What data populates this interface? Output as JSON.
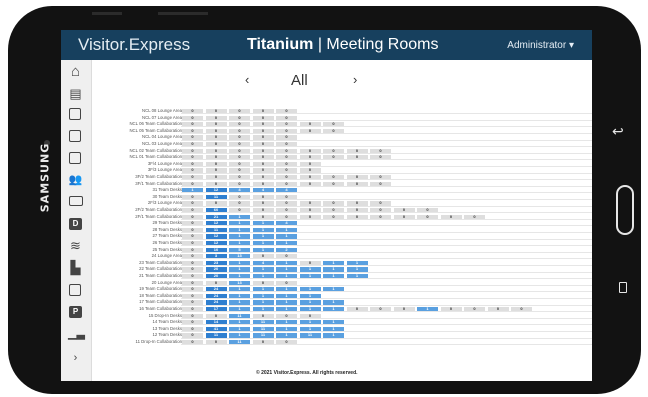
{
  "device": {
    "brand": "SAMSUNG"
  },
  "app": {
    "logo": "Visitor.Express",
    "title_bold": "Titanium",
    "title_rest": " | Meeting Rooms",
    "user": "Administrator",
    "user_caret": "▾"
  },
  "sidebar": {
    "items": [
      {
        "icon": "home-icon"
      },
      {
        "icon": "building-icon"
      },
      {
        "icon": "calendar-add-icon"
      },
      {
        "icon": "badge-icon"
      },
      {
        "icon": "calendar-list-icon"
      },
      {
        "icon": "people-icon"
      },
      {
        "icon": "monitor-icon"
      },
      {
        "icon": "d-icon",
        "glyph": "D"
      },
      {
        "icon": "layers-icon"
      },
      {
        "icon": "door-icon"
      },
      {
        "icon": "calendar-icon"
      },
      {
        "icon": "parking-icon",
        "glyph": "P"
      },
      {
        "icon": "chart-icon"
      },
      {
        "icon": "expand-icon"
      }
    ]
  },
  "nav": {
    "prev": "‹",
    "filter": "All",
    "next": "›"
  },
  "rooms": [
    {
      "name": "NCL 08 Lounge Area",
      "values": [
        "0",
        "0",
        "0",
        "0",
        "0"
      ]
    },
    {
      "name": "NCL 07 Lounge Area",
      "values": [
        "0",
        "0",
        "0",
        "0",
        "0"
      ]
    },
    {
      "name": "NCL 06 Team Collaboration",
      "values": [
        "0",
        "0",
        "0",
        "0",
        "0",
        "0",
        "0"
      ]
    },
    {
      "name": "NCL 05 Team Collaboration",
      "values": [
        "0",
        "0",
        "0",
        "0",
        "0",
        "0",
        "0"
      ]
    },
    {
      "name": "NCL 04 Lounge Area",
      "values": [
        "0",
        "0",
        "0",
        "0",
        "0"
      ]
    },
    {
      "name": "NCL 03 Lounge Area",
      "values": [
        "0",
        "0",
        "0",
        "0",
        "0"
      ]
    },
    {
      "name": "NCL 02 Team Collaboration",
      "values": [
        "0",
        "0",
        "0",
        "0",
        "0",
        "0",
        "0",
        "0",
        "0"
      ]
    },
    {
      "name": "NCL 01 Team Collaboration",
      "values": [
        "0",
        "0",
        "0",
        "0",
        "0",
        "0",
        "0",
        "0",
        "0"
      ]
    },
    {
      "name": "3F/4 Lounge Area",
      "values": [
        "0",
        "0",
        "0",
        "0",
        "0",
        "0"
      ]
    },
    {
      "name": "3F/3 Lounge Area",
      "values": [
        "0",
        "0",
        "0",
        "0",
        "0",
        "0"
      ]
    },
    {
      "name": "3F/2 Team Collaboration",
      "values": [
        "0",
        "0",
        "0",
        "0",
        "0",
        "0",
        "0",
        "0",
        "0"
      ]
    },
    {
      "name": "3F/1 Team Collaboration",
      "values": [
        "0",
        "0",
        "0",
        "0",
        "0",
        "0",
        "0",
        "0",
        "0"
      ]
    },
    {
      "name": "31 Team Desks",
      "values": [
        "1",
        "12",
        "4",
        "4",
        "4"
      ],
      "hl": [
        0,
        1,
        2,
        3,
        4
      ]
    },
    {
      "name": "30 Team Desks",
      "values": [
        "0",
        "11",
        "0",
        "0",
        "0"
      ],
      "hl": [
        1
      ]
    },
    {
      "name": "2F/3 Lounge Area",
      "values": [
        "0",
        "0",
        "0",
        "0",
        "0",
        "0",
        "0",
        "0",
        "0"
      ]
    },
    {
      "name": "2F/2 Team Collaboration",
      "values": [
        "0",
        "60",
        "0",
        "0",
        "0",
        "0",
        "0",
        "0",
        "0",
        "0",
        "0"
      ],
      "hl": [
        1
      ]
    },
    {
      "name": "2F/1 Team Collaboration",
      "values": [
        "0",
        "21",
        "1",
        "0",
        "0",
        "0",
        "0",
        "0",
        "0",
        "0",
        "0",
        "0",
        "0"
      ],
      "hl": [
        1,
        2
      ]
    },
    {
      "name": "29 Team Desks",
      "values": [
        "0",
        "12",
        "1",
        "1",
        "4"
      ],
      "hl": [
        1,
        2,
        3,
        4
      ]
    },
    {
      "name": "28 Team Desks",
      "values": [
        "0",
        "11",
        "1",
        "1",
        "1"
      ],
      "hl": [
        1,
        2,
        3,
        4
      ]
    },
    {
      "name": "27 Team Desks",
      "values": [
        "0",
        "12",
        "1",
        "1",
        "1"
      ],
      "hl": [
        1,
        2,
        3,
        4
      ]
    },
    {
      "name": "26 Team Desks",
      "values": [
        "0",
        "12",
        "1",
        "1",
        "1"
      ],
      "hl": [
        1,
        2,
        3,
        4
      ]
    },
    {
      "name": "25 Team Desks",
      "values": [
        "0",
        "10",
        "5",
        "1",
        "2"
      ],
      "hl": [
        1,
        2,
        3,
        4
      ]
    },
    {
      "name": "24 Lounge Area",
      "values": [
        "0",
        "3",
        "13",
        "0",
        "0"
      ],
      "hl": [
        1,
        2
      ]
    },
    {
      "name": "23 Team Collaboration",
      "values": [
        "0",
        "23",
        "1",
        "4",
        "1",
        "0",
        "1",
        "1"
      ],
      "hl": [
        1,
        2,
        3,
        4,
        6,
        7
      ]
    },
    {
      "name": "22 Team Collaboration",
      "values": [
        "0",
        "20",
        "1",
        "1",
        "1",
        "1",
        "1",
        "1"
      ],
      "hl": [
        1,
        2,
        3,
        4,
        5,
        6,
        7
      ]
    },
    {
      "name": "21 Team Collaboration",
      "values": [
        "0",
        "20",
        "1",
        "1",
        "1",
        "1",
        "1",
        "1"
      ],
      "hl": [
        1,
        2,
        3,
        4,
        5,
        6,
        7
      ]
    },
    {
      "name": "20 Lounge Area",
      "values": [
        "0",
        "0",
        "13",
        "0",
        "0"
      ],
      "hl": [
        2
      ]
    },
    {
      "name": "19 Team Collaboration",
      "values": [
        "0",
        "24",
        "1",
        "1",
        "1",
        "1",
        "1"
      ],
      "hl": [
        1,
        2,
        3,
        4,
        5,
        6
      ]
    },
    {
      "name": "18 Team Collaboration",
      "values": [
        "0",
        "24",
        "1",
        "1",
        "1",
        "1"
      ],
      "hl": [
        1,
        2,
        3,
        4,
        5
      ]
    },
    {
      "name": "17 Team Collaboration",
      "values": [
        "0",
        "24",
        "1",
        "1",
        "1",
        "1",
        "1"
      ],
      "hl": [
        1,
        2,
        3,
        4,
        5,
        6
      ]
    },
    {
      "name": "16 Team Collaboration",
      "values": [
        "0",
        "17",
        "1",
        "1",
        "1",
        "1",
        "1",
        "0",
        "0",
        "0",
        "1",
        "0",
        "0",
        "0",
        "0"
      ],
      "hl": [
        1,
        2,
        3,
        4,
        5,
        6,
        10
      ]
    },
    {
      "name": "15 Drop-In Desks",
      "values": [
        "0",
        "0",
        "11",
        "0",
        "0",
        "0"
      ],
      "hl": [
        2
      ]
    },
    {
      "name": "14 Team Desks",
      "values": [
        "0",
        "14",
        "1",
        "11",
        "1",
        "1",
        "1"
      ],
      "hl": [
        1,
        2,
        3,
        4,
        5,
        6
      ]
    },
    {
      "name": "13 Team Desks",
      "values": [
        "0",
        "41",
        "1",
        "11",
        "1",
        "1",
        "1"
      ],
      "hl": [
        1,
        2,
        3,
        4,
        5,
        6
      ]
    },
    {
      "name": "12 Team Desks",
      "values": [
        "0",
        "11",
        "1",
        "11",
        "1",
        "11",
        "1"
      ],
      "hl": [
        1,
        2,
        3,
        4,
        5,
        6
      ]
    },
    {
      "name": "11 Drop-In Collaboration",
      "values": [
        "0",
        "0",
        "11",
        "0",
        "0"
      ],
      "hl": [
        2
      ]
    }
  ],
  "footer": "© 2021 Visitor.Express. All rights reserved."
}
